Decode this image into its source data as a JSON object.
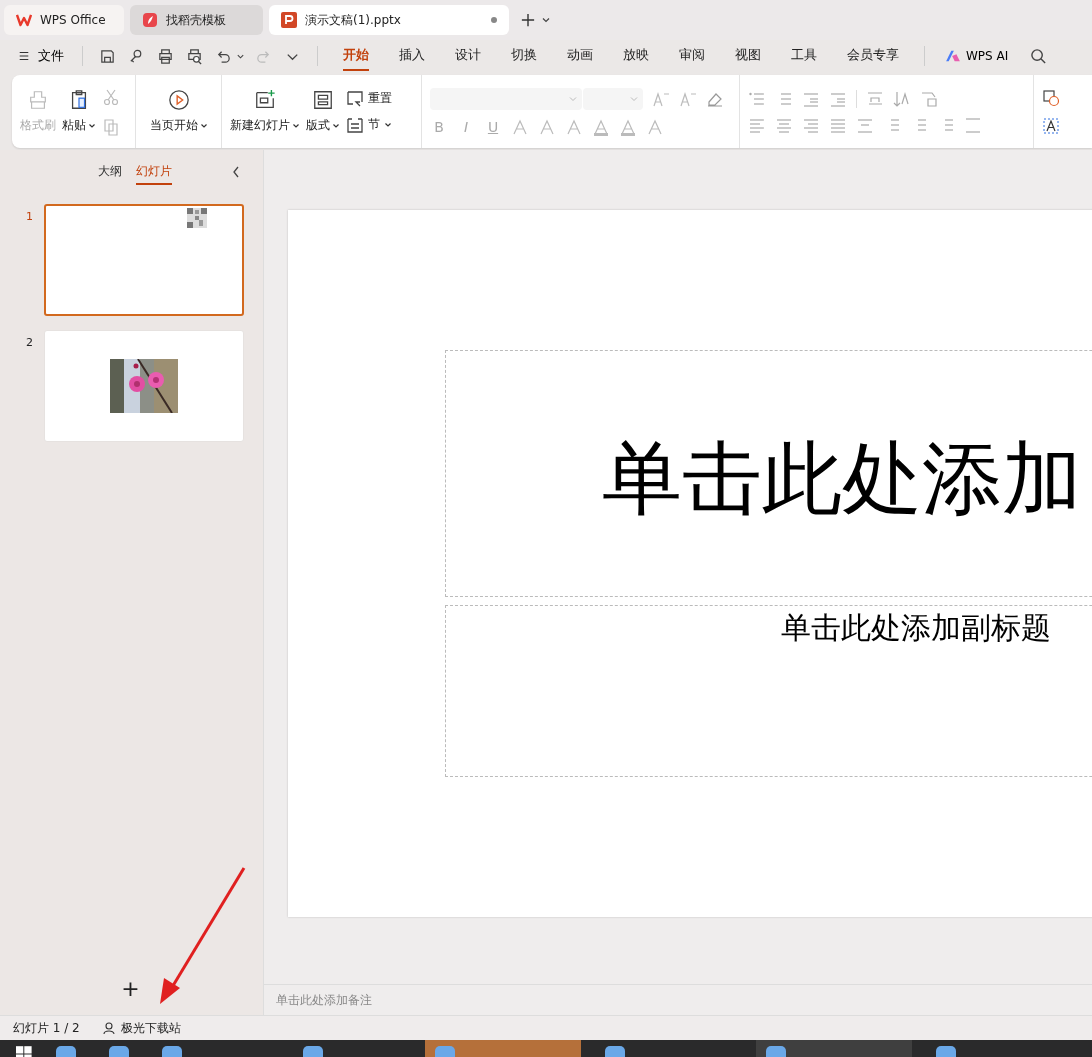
{
  "tabs": [
    {
      "label": "WPS Office",
      "kind": "home",
      "selected": false
    },
    {
      "label": "找稻壳模板",
      "kind": "template",
      "selected": false
    },
    {
      "label": "演示文稿(1).pptx",
      "kind": "document",
      "selected": true
    }
  ],
  "file_menu": "文件",
  "ribbon_tabs": [
    {
      "label": "开始",
      "selected": true
    },
    {
      "label": "插入",
      "selected": false
    },
    {
      "label": "设计",
      "selected": false
    },
    {
      "label": "切换",
      "selected": false
    },
    {
      "label": "动画",
      "selected": false
    },
    {
      "label": "放映",
      "selected": false
    },
    {
      "label": "审阅",
      "selected": false
    },
    {
      "label": "视图",
      "selected": false
    },
    {
      "label": "工具",
      "selected": false
    },
    {
      "label": "会员专享",
      "selected": false
    }
  ],
  "wps_ai": "WPS AI",
  "ribbon": {
    "format_painter": {
      "label": "格式刷",
      "disabled": true
    },
    "paste": "粘贴",
    "start_from_current": "当页开始",
    "new_slide": "新建幻灯片",
    "layout": "版式",
    "reset": "重置",
    "section": "节",
    "format_buttons": [
      "B",
      "I",
      "U"
    ]
  },
  "panel_tabs": [
    {
      "label": "大纲",
      "selected": false
    },
    {
      "label": "幻灯片",
      "selected": true
    }
  ],
  "slides": [
    {
      "number": "1",
      "selected": true,
      "kind": "qr"
    },
    {
      "number": "2",
      "selected": false,
      "kind": "picture"
    }
  ],
  "add_slide": "+",
  "slide": {
    "title": "单击此处添加",
    "subtitle": "单击此处添加副标题"
  },
  "notes_placeholder": "单击此处添加备注",
  "status_bar": {
    "slide_count": "幻灯片 1 / 2",
    "account": "极光下载站"
  }
}
